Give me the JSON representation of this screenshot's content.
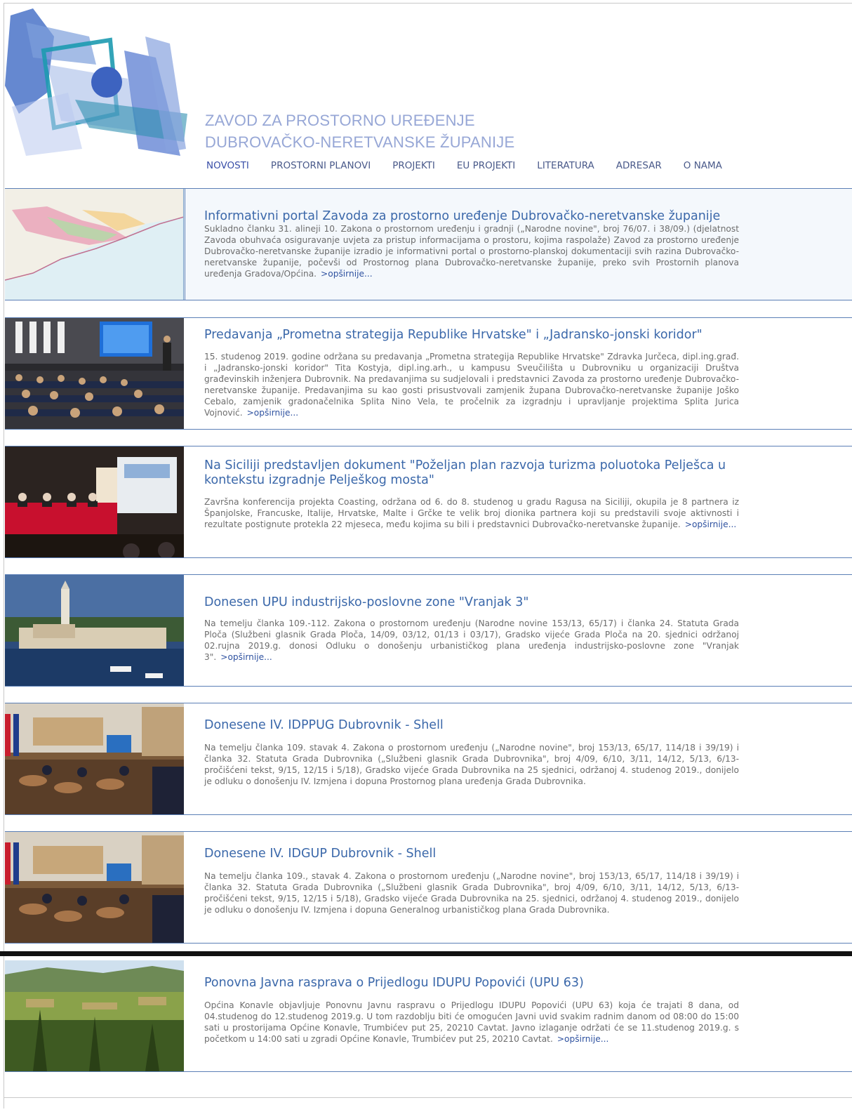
{
  "header": {
    "title_line1": "ZAVOD ZA PROSTORNO UREĐENJE",
    "title_line2": "DUBROVAČKO-NERETVANSKE ŽUPANIJE",
    "nav": [
      "NOVOSTI",
      "PROSTORNI PLANOVI",
      "PROJEKTI",
      "EU PROJEKTI",
      "LITERATURA",
      "ADRESAR",
      "O NAMA"
    ]
  },
  "entries": [
    {
      "title": "Informativni portal Zavoda za prostorno uređenje Dubrovačko-neretvanske županije",
      "text": "Sukladno članku 31. alineji 10. Zakona o prostornom uređenju i gradnji („Narodne novine\", broj 76/07. i 38/09.) (djelatnost Zavoda obuhvaća osiguravanje uvjeta za pristup informacijama o prostoru, kojima raspolaže) Zavod za prostorno uređenje Dubrovačko-neretvanske županije izradio je informativni portal o prostorno-planskoj dokumentaciji svih razina Dubrovačko-neretvanske županije, počevši od Prostornog plana Dubrovačko-neretvanske županije, preko svih Prostornih planova uređenja Gradova/Općina.",
      "more": ">opširnije..."
    },
    {
      "title": "Predavanja „Prometna strategija Republike Hrvatske\" i „Jadransko-jonski koridor\"",
      "text": "15. studenog 2019. godine održana su predavanja „Prometna strategija Republike Hrvatske\" Zdravka Jurčeca, dipl.ing.građ. i „Jadransko-jonski koridor\" Tita Kostyja, dipl.ing.arh., u kampusu Sveučilišta u Dubrovniku u organizaciji Društva građevinskih inženjera Dubrovnik. Na predavanjima su sudjelovali i predstavnici Zavoda za prostorno uređenje Dubrovačko-neretvanske županije. Predavanjima su kao gosti prisustvovali zamjenik župana Dubrovačko-neretvanske županije Joško Cebalo, zamjenik gradonačelnika Splita Nino Vela, te pročelnik za izgradnju i upravljanje projektima Splita Jurica Vojnović.",
      "more": ">opširnije..."
    },
    {
      "title": "Na Siciliji predstavljen dokument \"Poželjan plan razvoja turizma poluotoka Pelješca u kontekstu izgradnje Pelješkog mosta\"",
      "text": "Završna konferencija projekta Coasting, održana od 6. do 8. studenog u gradu Ragusa na Siciliji, okupila je 8 partnera iz Španjolske, Francuske, Italije, Hrvatske, Malte i Grčke te velik broj dionika partnera koji su predstavili svoje aktivnosti i rezultate postignute protekla 22 mjeseca, među kojima su bili i predstavnici Dubrovačko-neretvanske županije.",
      "more": ">opširnije..."
    },
    {
      "title": "Donesen UPU industrijsko-poslovne zone \"Vranjak 3\"",
      "text": "Na temelju članka 109.-112. Zakona o prostornom uređenju (Narodne novine 153/13, 65/17) i članka 24. Statuta Grada Ploča (Službeni glasnik Grada Ploča, 14/09, 03/12, 01/13 i 03/17), Gradsko vijeće Grada Ploča na 20. sjednici održanoj 02.rujna 2019.g. donosi Odluku o donošenju urbanističkog plana uređenja industrijsko-poslovne zone \"Vranjak 3\".",
      "more": ">opširnije..."
    },
    {
      "title": "Donesene IV. IDPPUG Dubrovnik - Shell",
      "text": "Na temelju članka 109. stavak 4. Zakona o prostornom uređenju („Narodne novine\", broj 153/13, 65/17, 114/18 i 39/19) i članka 32. Statuta Grada Dubrovnika („Službeni glasnik Grada Dubrovnika\", broj 4/09, 6/10, 3/11, 14/12, 5/13, 6/13-pročišćeni tekst, 9/15, 12/15 i 5/18), Gradsko vijeće Grada Dubrovnika na 25 sjednici, održanoj 4. studenog 2019., donijelo je odluku o donošenju IV. Izmjena i dopuna Prostornog plana uređenja Grada Dubrovnika.",
      "more": ""
    },
    {
      "title": "Donesene IV. IDGUP Dubrovnik - Shell",
      "text": "Na temelju članka 109., stavak 4. Zakona o prostornom uređenju („Narodne novine\", broj 153/13, 65/17, 114/18 i 39/19) i članka 32. Statuta Grada Dubrovnika („Službeni glasnik Grada Dubrovnika\", broj 4/09, 6/10, 3/11, 14/12, 5/13, 6/13-pročišćeni tekst, 9/15, 12/15 i 5/18), Gradsko vijeće Grada Dubrovnika na 25. sjednici, održanoj 4. studenog 2019., donijelo je odluku o donošenju IV. Izmjena i dopuna Generalnog urbanističkog plana Grada Dubrovnika.",
      "more": ""
    },
    {
      "title": "Ponovna Javna rasprava o Prijedlogu IDUPU Popovići (UPU 63)",
      "text": "Općina Konavle objavljuje Ponovnu Javnu raspravu o Prijedlogu IDUPU Popovići (UPU 63) koja će trajati 8 dana, od 04.studenog do 12.studenog 2019.g. U tom razdoblju biti će omogućen Javni uvid svakim radnim danom od 08:00 do 15:00 sati u prostorijama Općine Konavle, Trumbićev put 25, 20210 Cavtat. Javno izlaganje održati će se 11.studenog 2019.g. s početkom u 14:00 sati u zgradi Općine Konavle, Trumbićev put 25, 20210 Cavtat.",
      "more": ">opširnije..."
    }
  ]
}
